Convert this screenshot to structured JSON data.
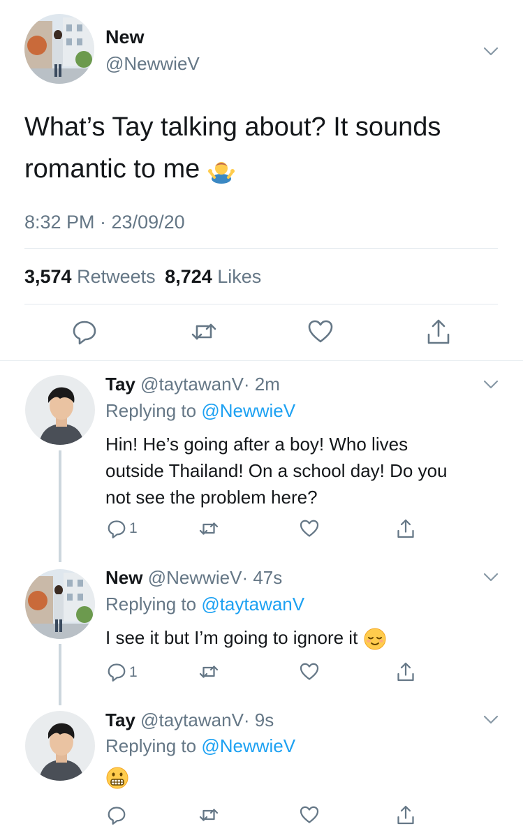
{
  "main_tweet": {
    "display_name": "New",
    "handle": "@NewwieV",
    "text": "What’s Tay talking about? It sounds romantic to me",
    "text_emoji": "shrug-emoji",
    "timestamp": "8:32 PM · 23/09/20",
    "retweets_count": "3,574",
    "retweets_label": "Retweets",
    "likes_count": "8,724",
    "likes_label": "Likes"
  },
  "replies": [
    {
      "display_name": "Tay",
      "handle": "@taytawanV",
      "time": "· 2m",
      "replying_label": "Replying to",
      "replying_to": "@NewwieV",
      "text_line1": "Hin! He’s going after a boy! Who lives",
      "text_line2": "outside Thailand! On a school day! Do you",
      "text_line3": "not see the problem here?",
      "reply_count": "1"
    },
    {
      "display_name": "New",
      "handle": "@NewwieV",
      "time": "· 47s",
      "replying_label": "Replying to",
      "replying_to": "@taytawanV",
      "text_line1": "I see it but I’m going to ignore it",
      "text_emoji": "relieved-face-emoji",
      "reply_count": "1"
    },
    {
      "display_name": "Tay",
      "handle": "@taytawanV",
      "time": "· 9s",
      "replying_label": "Replying to",
      "replying_to": "@NewwieV",
      "text_emoji": "grimacing-face-emoji"
    }
  ],
  "colors": {
    "link_blue": "#1da1f2",
    "gray_text": "#657786",
    "divider": "#e1e8ed",
    "thread_line": "#ccd6dd"
  }
}
